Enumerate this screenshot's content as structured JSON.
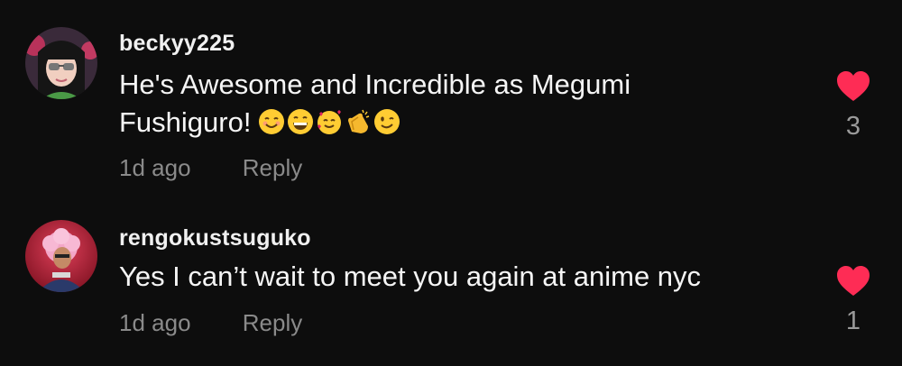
{
  "comments": [
    {
      "username": "beckyy225",
      "text": "He's Awesome and Incredible as Megumi Fushiguro!",
      "emojis": [
        "smiling-face-emoji",
        "grinning-face-emoji",
        "smiling-face-with-hearts-emoji",
        "clapping-hands-emoji",
        "winking-face-emoji"
      ],
      "time": "1d ago",
      "reply_label": "Reply",
      "like_count": "3",
      "liked": true
    },
    {
      "username": "rengokustsuguko",
      "text": "Yes I can’t wait to meet you again at anime nyc",
      "time": "1d ago",
      "reply_label": "Reply",
      "like_count": "1",
      "liked": true
    }
  ],
  "colors": {
    "background": "#0d0d0d",
    "heart": "#fe2c55",
    "muted_text": "#8a8a8a"
  }
}
